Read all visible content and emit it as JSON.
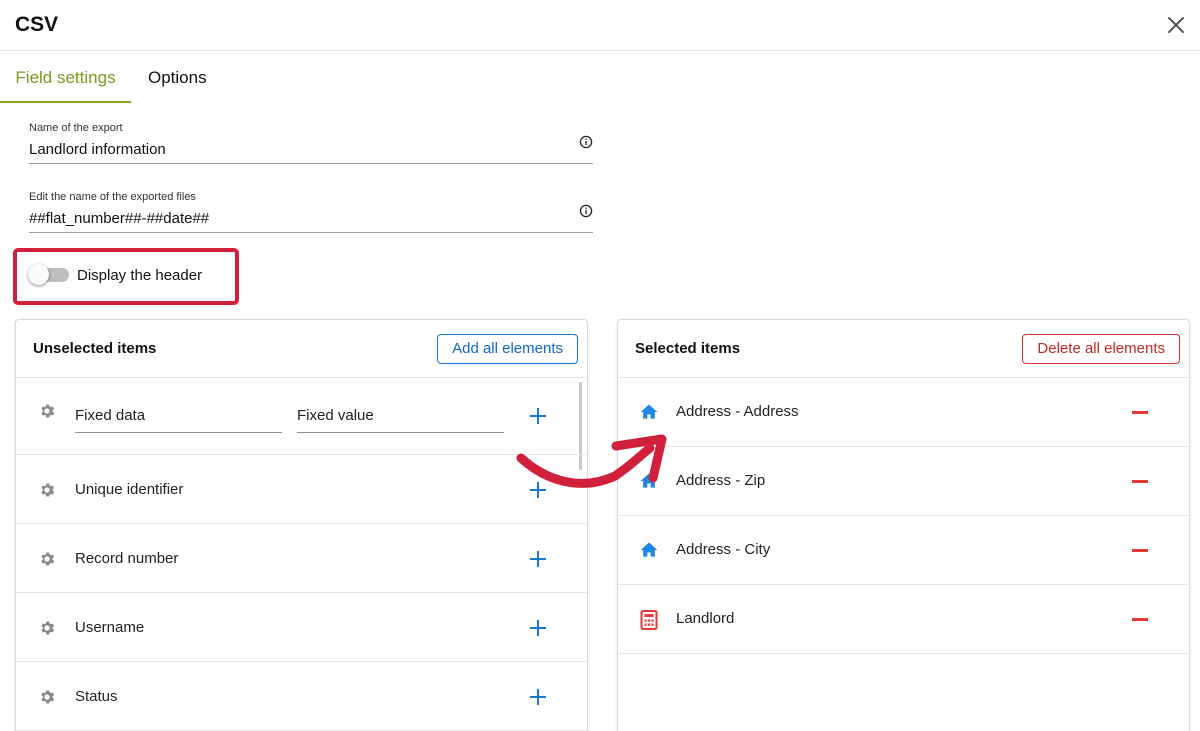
{
  "dialog": {
    "title": "CSV"
  },
  "tabs": [
    {
      "label": "Field settings",
      "active": true
    },
    {
      "label": "Options",
      "active": false
    }
  ],
  "export_name": {
    "label": "Name of the export",
    "value": "Landlord information"
  },
  "file_name": {
    "label": "Edit the name of the exported files",
    "value": "##flat_number##-##date##"
  },
  "header_toggle": {
    "label": "Display the header",
    "checked": false
  },
  "unselected": {
    "title": "Unselected items",
    "add_all_label": "Add all elements",
    "fixed_row": {
      "data_value": "Fixed data",
      "value_value": "Fixed value"
    },
    "items": [
      {
        "label": "Unique identifier"
      },
      {
        "label": "Record number"
      },
      {
        "label": "Username"
      },
      {
        "label": "Status"
      }
    ]
  },
  "selected": {
    "title": "Selected items",
    "delete_all_label": "Delete all elements",
    "items": [
      {
        "label": "Address - Address",
        "icon": "home-icon"
      },
      {
        "label": "Address - Zip",
        "icon": "home-icon"
      },
      {
        "label": "Address - City",
        "icon": "home-icon"
      },
      {
        "label": "Landlord",
        "icon": "calculator-icon"
      }
    ]
  },
  "colors": {
    "accent_green": "#8aa51f",
    "primary_blue": "#1976d2",
    "danger_red": "#d32f2f",
    "annotation_red": "#d2203c"
  }
}
